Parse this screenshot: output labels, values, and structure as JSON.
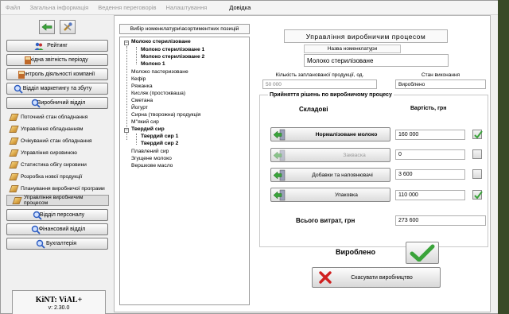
{
  "menu": {
    "items": [
      "Файл",
      "Загальна інформація",
      "Ведення переговорів",
      "Налаштування",
      "Довідка"
    ]
  },
  "sidebar": {
    "buttons": [
      {
        "label": "Рейтинг",
        "icon": "users-icon"
      },
      {
        "label": "Вхідна звітність періоду",
        "icon": "book-icon"
      },
      {
        "label": "Контроль діяльності компанії",
        "icon": "book-icon"
      },
      {
        "label": "Відділ маркетингу та збуту",
        "icon": "search-icon"
      },
      {
        "label": "Виробничий відділ",
        "icon": "search-icon"
      }
    ],
    "subitems": [
      "Поточний стан обладнання",
      "Управління обладнанням",
      "Очікуваний стан обладнання",
      "Управління сировиною",
      "Статистика обігу сировини",
      "Розробка нової продукції",
      "Планування виробничої програми",
      "Управління виробничим процесом"
    ],
    "buttons2": [
      {
        "label": "Відділ персоналу",
        "icon": "search-icon"
      },
      {
        "label": "Фінансовий відділ",
        "icon": "search-icon"
      },
      {
        "label": "Бухгалтерія",
        "icon": "search-icon"
      }
    ],
    "logo": {
      "title": "KiNT: ViAL+",
      "version": "v: 2.30.0"
    }
  },
  "tree": {
    "header": "Вибір номенклатури\\асортиментних позицій",
    "nodes": [
      "Молоко стерилізоване",
      "Молоко стерилізоване 1",
      "Молоко стерилізоване 2",
      "Молоко 1",
      "Молоко пастеризоване",
      "Кефір",
      "Ряжанка",
      "Кисляк (простокваша)",
      "Сметана",
      "Йогурт",
      "Сирна (творожна) продукція",
      "М''який сир",
      "Твердий сир",
      "Твердий сир 1",
      "Твердий сир 2",
      "Плавлений сир",
      "Згущене молоко",
      "Вершкове масло"
    ]
  },
  "panel": {
    "title": "Управління виробничим процесом",
    "nomenclature_label": "Назва номенклатури",
    "nomenclature_value": "Молоко стерилізоване",
    "qty_label": "Кількість запланованої продукції, од.",
    "qty_value": "50 000",
    "status_label": "Стан виконання",
    "status_value": "Вироблено",
    "group_title": "Прийняття рішень по виробничому процесу",
    "col_components": "Складові",
    "col_cost": "Вартість, грн",
    "rows": [
      {
        "label": "Нормалізоване молоко",
        "value": "160 000",
        "checked": true
      },
      {
        "label": "Закваска",
        "value": "0",
        "checked": false
      },
      {
        "label": "Добавки та наповнювачі",
        "value": "3 600",
        "checked": false
      },
      {
        "label": "Упаковка",
        "value": "110 000",
        "checked": true
      }
    ],
    "total_label": "Всього витрат, грн",
    "total_value": "273 600",
    "produced_label": "Вироблено",
    "cancel_label": "Скасувати виробництво"
  },
  "colors": {
    "accent_green": "#3aa33a",
    "cancel_red": "#d02020"
  }
}
